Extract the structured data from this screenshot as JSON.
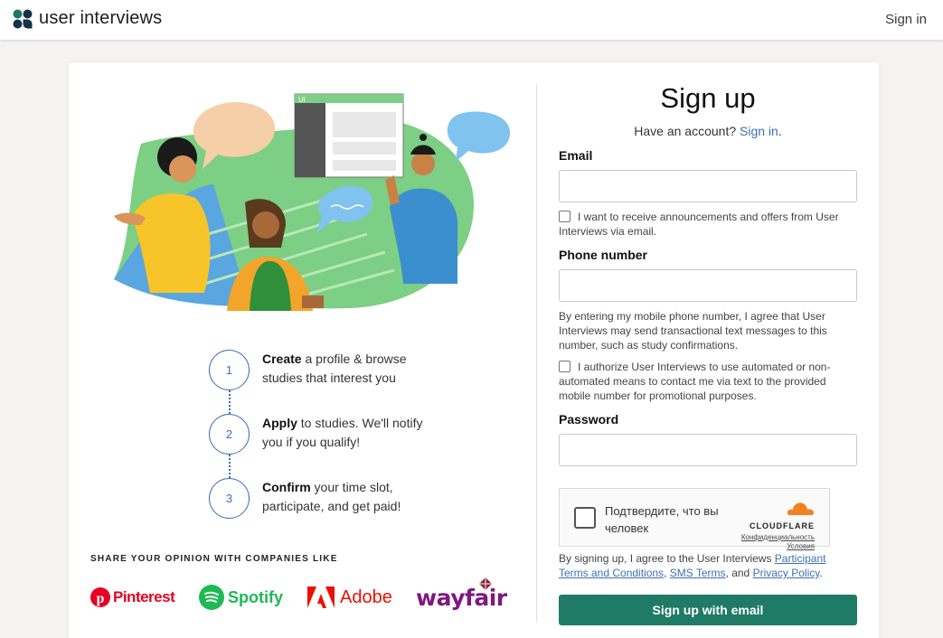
{
  "header": {
    "logo_text": "user interviews",
    "signin_label": "Sign in"
  },
  "illustration": {
    "screen_label": "UI"
  },
  "steps": [
    {
      "number": "1",
      "bold": "Create",
      "text": " a profile & browse studies that interest you"
    },
    {
      "number": "2",
      "bold": "Apply",
      "text": " to studies. We'll notify you if you qualify!"
    },
    {
      "number": "3",
      "bold": "Confirm",
      "text": " your time slot, participate, and get paid!"
    }
  ],
  "share": {
    "label": "SHARE YOUR OPINION WITH COMPANIES LIKE",
    "brands": [
      {
        "name": "Pinterest",
        "color": "#e60023"
      },
      {
        "name": "Spotify",
        "color": "#1db954"
      },
      {
        "name": "Adobe",
        "color": "#eb1000"
      },
      {
        "name": "wayfair",
        "color": "#7f187f"
      }
    ]
  },
  "form": {
    "title": "Sign up",
    "have_account": "Have an account?",
    "signin_link": "Sign in",
    "period": ".",
    "email_label": "Email",
    "email_value": "",
    "announce_text": "I want to receive announcements and offers from User Interviews via email.",
    "phone_label": "Phone number",
    "phone_value": "",
    "phone_note": "By entering my mobile phone number, I agree that User Interviews may send transactional text messages to this number, such as study confirmations.",
    "autotext_text": "I authorize User Interviews to use automated or non-automated means to contact me via text to the provided mobile number for promotional purposes.",
    "password_label": "Password",
    "password_value": "",
    "captcha_text": "Подтвердите, что вы человек",
    "captcha_brand": "CLOUDFLARE",
    "captcha_link1": "Конфиденциальность",
    "captcha_link2": "Условия",
    "terms_prefix": "By signing up, I agree to the User Interviews ",
    "terms_link1": "Participant Terms and Conditions",
    "terms_sep1": ", ",
    "terms_link2": "SMS Terms",
    "terms_sep2": ", and ",
    "terms_link3": "Privacy Policy",
    "terms_end": ".",
    "submit_label": "Sign up with email"
  },
  "colors": {
    "accent": "#1f7a66",
    "link": "#3d6fb6"
  }
}
